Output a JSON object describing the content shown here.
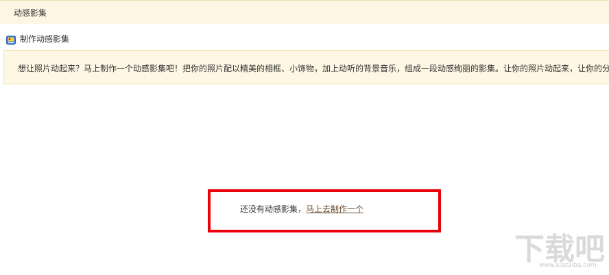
{
  "header": {
    "title": "动感影集"
  },
  "subhead": {
    "icon": "photo-album-icon",
    "label": "制作动感影集"
  },
  "notice": {
    "text": "想让照片动起来？马上制作一个动感影集吧！把你的照片配以精美的相框、小饰物，加上动听的背景音乐，组成一段动感绚丽的影集。让你的照片动起来，让你的分"
  },
  "empty_state": {
    "message": "还没有动感影集，",
    "link_label": "马上去制作一个"
  },
  "watermark": {
    "logo_text": "下载吧",
    "url": "www.xiazaiba.com"
  },
  "colors": {
    "header_bg": "#fcf6e3",
    "notice_bg": "#fdf7e4",
    "highlight_border": "#e8000b",
    "link": "#6b4a2a"
  }
}
